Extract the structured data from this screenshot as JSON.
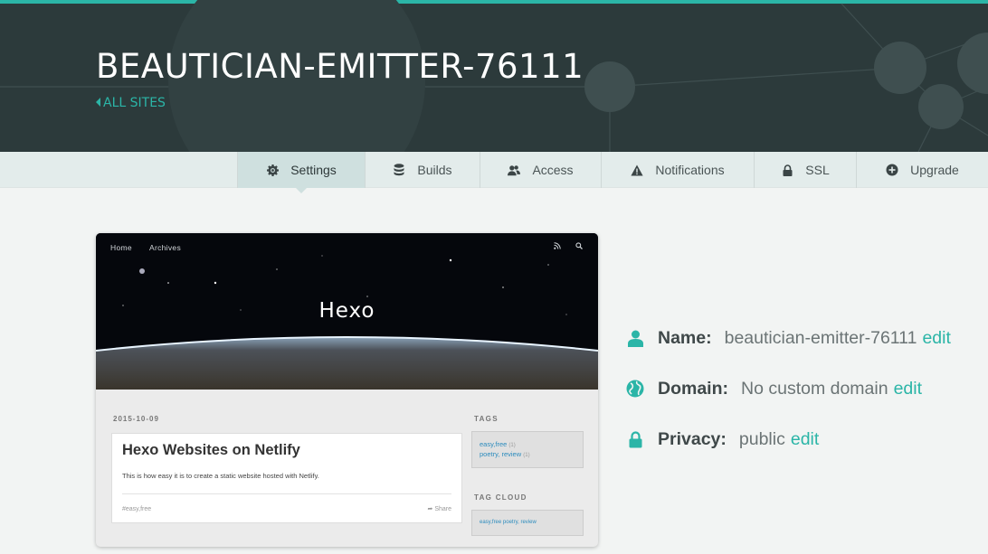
{
  "header": {
    "site_title": "BEAUTICIAN-EMITTER-76111",
    "all_sites_label": "ALL SITES",
    "accent_color": "#2bb5a7",
    "background_color": "#2c3a3b"
  },
  "nav": {
    "tabs": [
      {
        "label": "Settings",
        "icon": "gear-icon",
        "active": true
      },
      {
        "label": "Builds",
        "icon": "database-icon",
        "active": false
      },
      {
        "label": "Access",
        "icon": "users-icon",
        "active": false
      },
      {
        "label": "Notifications",
        "icon": "warning-icon",
        "active": false
      },
      {
        "label": "SSL",
        "icon": "lock-icon",
        "active": false
      },
      {
        "label": "Upgrade",
        "icon": "plus-circle-icon",
        "active": false
      }
    ]
  },
  "preview": {
    "nav_home": "Home",
    "nav_archives": "Archives",
    "blog_title": "Hexo",
    "post_date": "2015-10-09",
    "post_title": "Hexo Websites on Netlify",
    "post_excerpt": "This is how easy it is to create a static website hosted with Netlify.",
    "post_tag": "#easy,free",
    "share_label": "Share",
    "tags_heading": "TAGS",
    "tags": [
      {
        "name": "easy,free",
        "count": "(1)"
      },
      {
        "name": "poetry, review",
        "count": "(1)"
      }
    ],
    "tag_cloud_heading": "TAG CLOUD",
    "tag_cloud": "easy,free  poetry, review"
  },
  "info": {
    "name_label": "Name:",
    "name_value": "beautician-emitter-76111",
    "domain_label": "Domain:",
    "domain_value": "No custom domain",
    "privacy_label": "Privacy:",
    "privacy_value": "public",
    "edit_label": "edit"
  }
}
